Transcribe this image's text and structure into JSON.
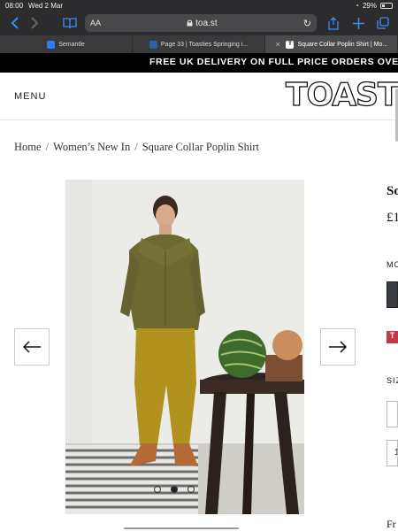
{
  "status_bar": {
    "time": "08:00",
    "date": "Wed 2 Mar",
    "battery": "29%"
  },
  "browser": {
    "address_aa": "AA",
    "url": "toa.st",
    "tabs": [
      {
        "label": "Semantle",
        "active": false
      },
      {
        "label": "Page 33 | Toasties Springing i...",
        "active": false
      },
      {
        "label": "Square Collar Poplin Shirt | Mo...",
        "active": true
      }
    ]
  },
  "promo": {
    "text": "FREE UK DELIVERY ON FULL PRICE ORDERS OVER £"
  },
  "header": {
    "menu_label": "MENU",
    "logo_text": "TOAST"
  },
  "breadcrumb": {
    "items": [
      "Home",
      "Women’s New In",
      "Square Collar Poplin Shirt"
    ],
    "separator": "/"
  },
  "gallery": {
    "total_slides": 3,
    "active_slide": 2
  },
  "product_panel": {
    "title_fragment": "Sq",
    "price_fragment": "£1",
    "colour_label_fragment": "MO",
    "badge_fragment": "T",
    "size_label_fragment": "SIZ",
    "size_option_fragment": "1",
    "footer_fragment": "Fr"
  },
  "colors": {
    "promo_bg": "#000000",
    "safari_chrome": "#2c2c2e",
    "accent_blue": "#3a8ef6",
    "badge_red": "#c0394b"
  }
}
